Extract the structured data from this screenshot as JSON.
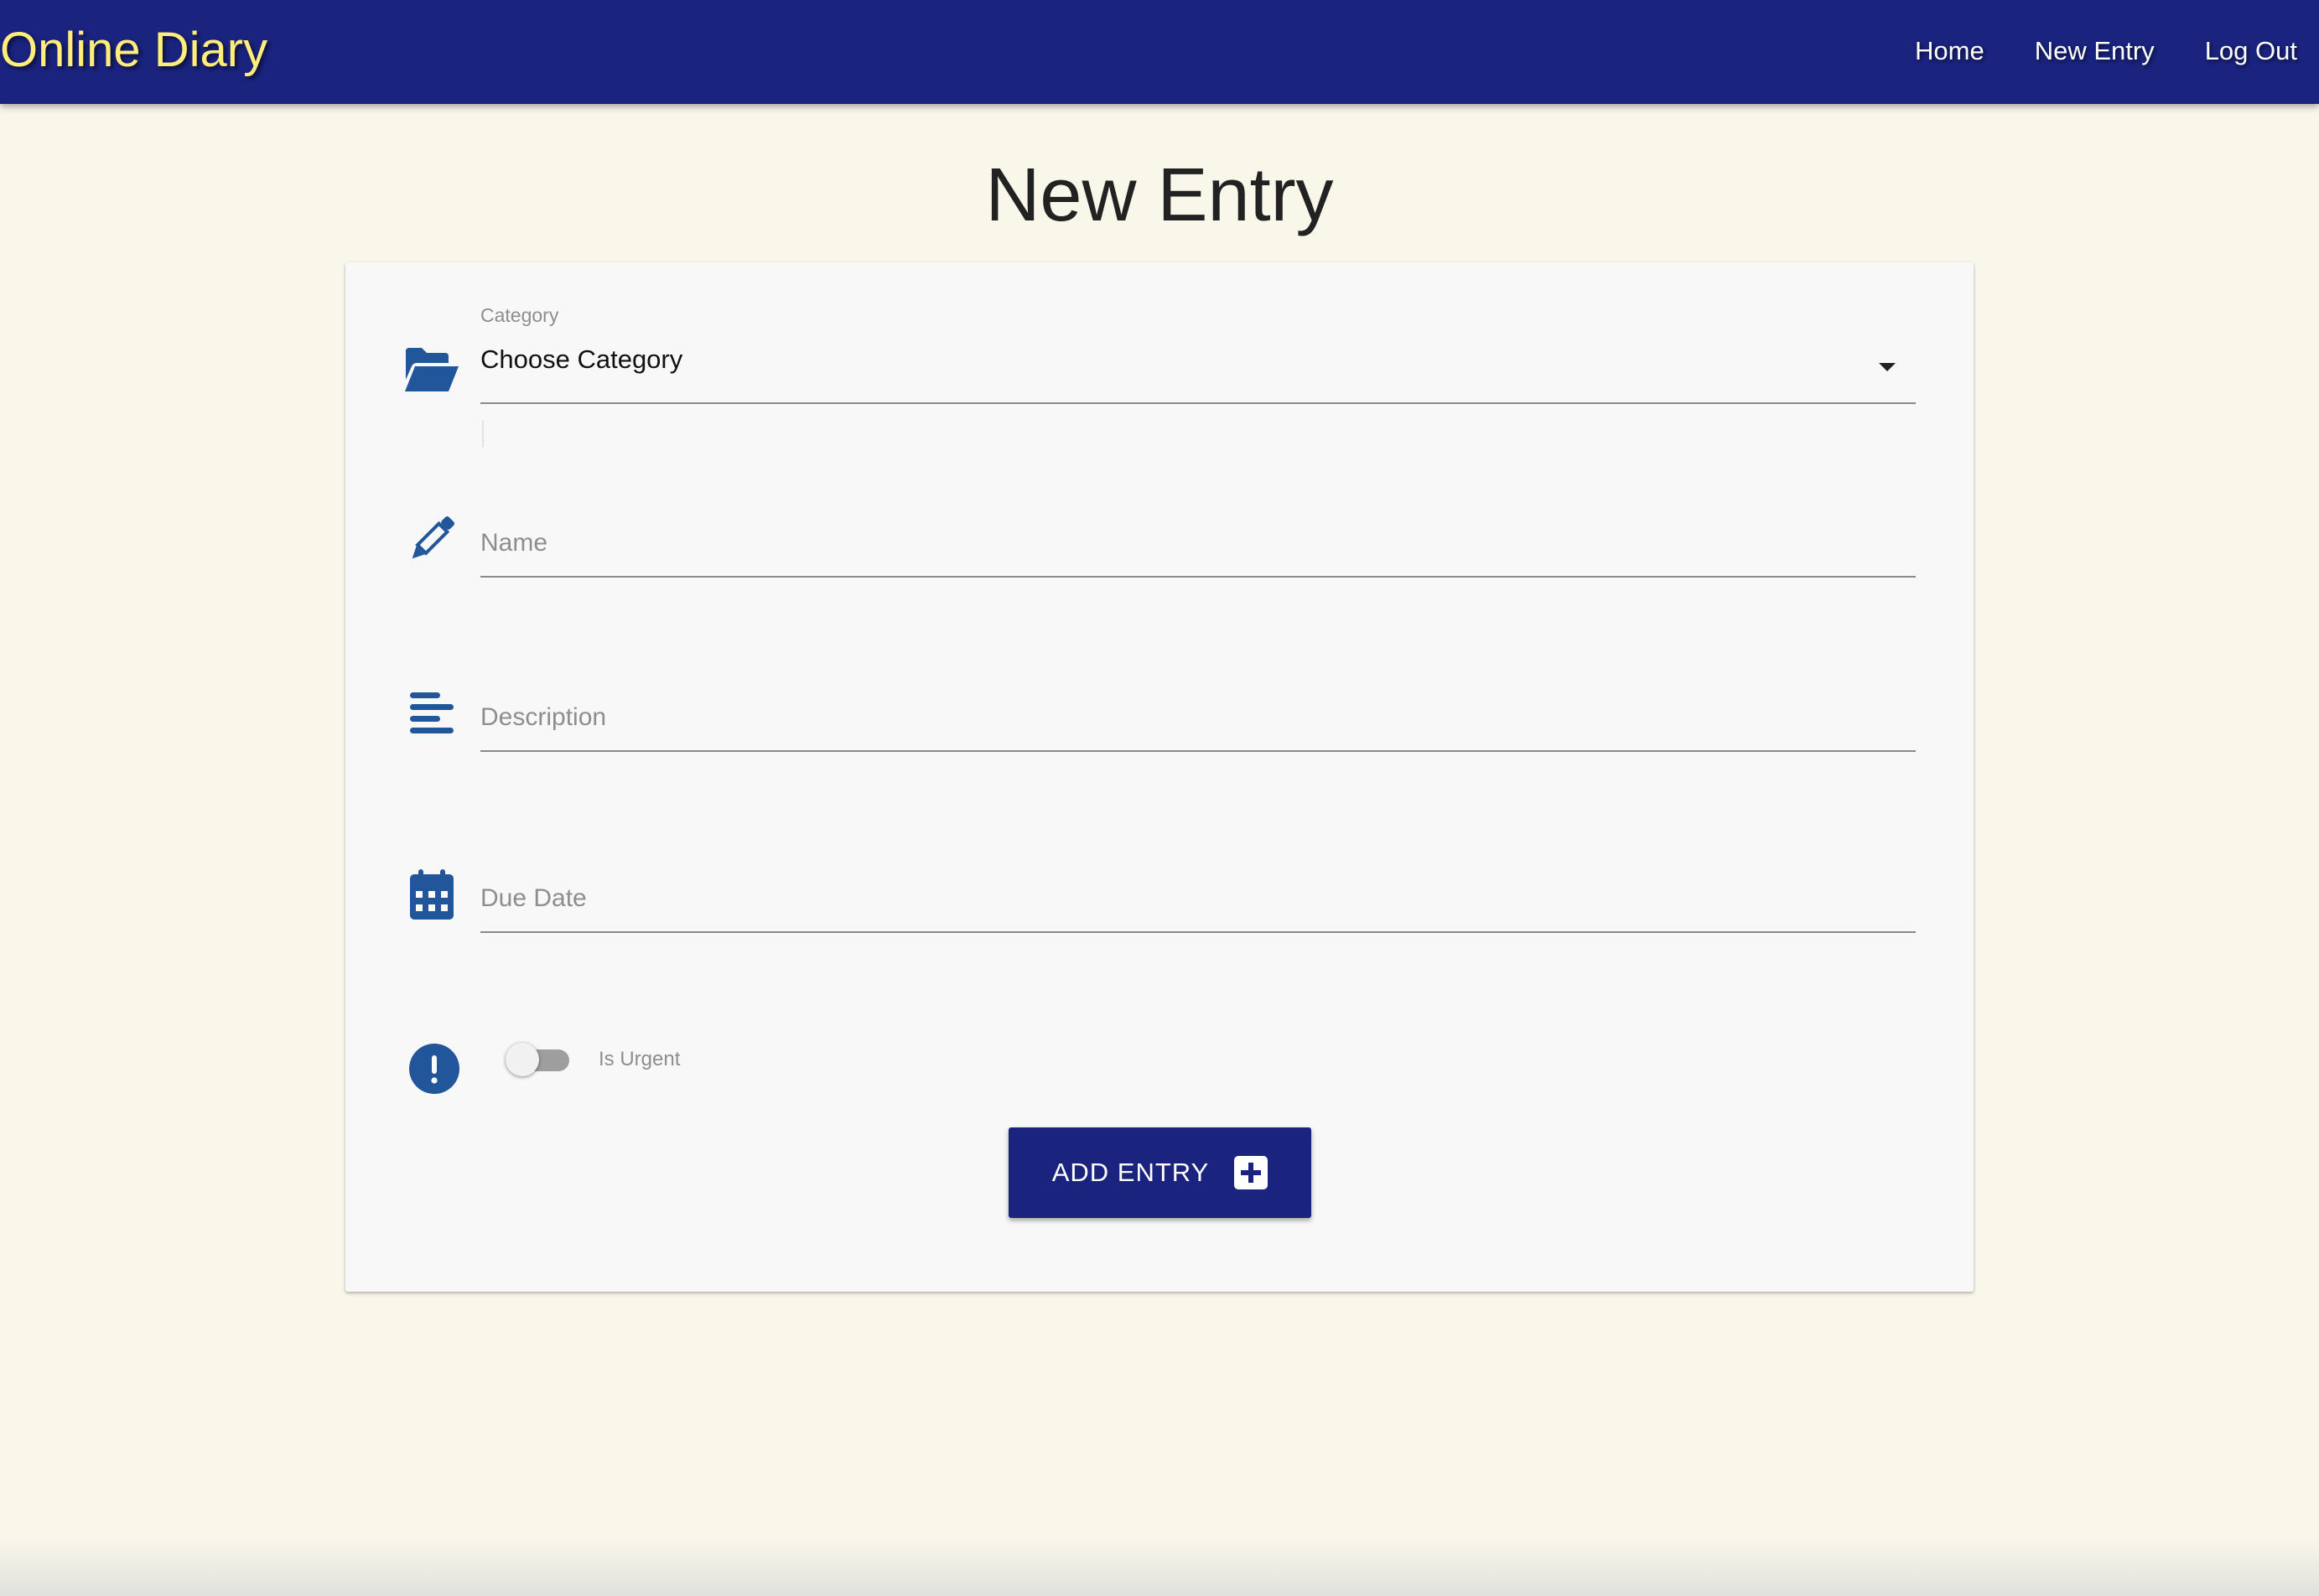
{
  "navbar": {
    "brand": "Online Diary",
    "links": [
      {
        "label": "Home"
      },
      {
        "label": "New Entry"
      },
      {
        "label": "Log Out"
      }
    ]
  },
  "page": {
    "title": "New Entry"
  },
  "form": {
    "category": {
      "label": "Category",
      "value": "Choose Category",
      "icon": "folder-open-icon"
    },
    "name": {
      "placeholder": "Name",
      "icon": "pencil-icon"
    },
    "description": {
      "placeholder": "Description",
      "icon": "align-left-icon"
    },
    "due_date": {
      "placeholder": "Due Date",
      "icon": "calendar-icon"
    },
    "urgent": {
      "label": "Is Urgent",
      "checked": false,
      "icon": "exclamation-circle-icon"
    },
    "submit": {
      "label": "ADD ENTRY",
      "icon": "plus-square-icon"
    }
  },
  "colors": {
    "navbar_bg": "#1a237e",
    "brand_text": "#ffee7a",
    "page_bg": "#f9f7ea",
    "card_bg": "#f8f8f8",
    "icon_blue": "#22569b",
    "button_bg": "#1a237e"
  }
}
